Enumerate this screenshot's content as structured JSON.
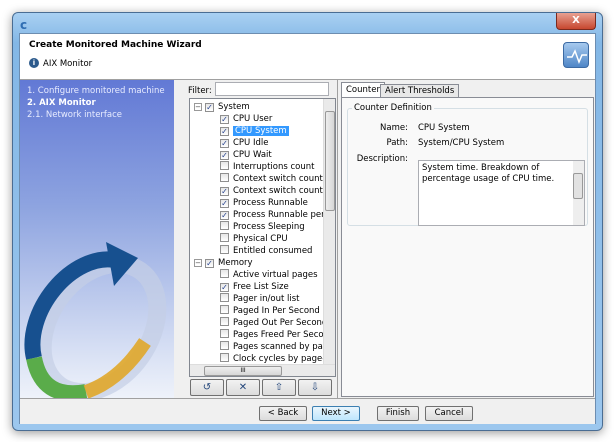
{
  "window": {
    "close_glyph": "X"
  },
  "header": {
    "title": "Create Monitored Machine Wizard",
    "subtitle": "AIX Monitor"
  },
  "steps": [
    {
      "label": "1. Configure monitored machine",
      "active": false
    },
    {
      "label": "2. AIX Monitor",
      "active": true
    },
    {
      "label": "2.1. Network interface",
      "active": false
    }
  ],
  "filter": {
    "label": "Filter:",
    "value": ""
  },
  "tree": [
    {
      "label": "System",
      "level": 0,
      "checked": true,
      "group": true
    },
    {
      "label": "CPU User",
      "level": 1,
      "checked": true
    },
    {
      "label": "CPU System",
      "level": 1,
      "checked": true,
      "selected": true
    },
    {
      "label": "CPU Idle",
      "level": 1,
      "checked": true
    },
    {
      "label": "CPU Wait",
      "level": 1,
      "checked": true
    },
    {
      "label": "Interruptions count",
      "level": 1,
      "checked": false
    },
    {
      "label": "Context switch count",
      "level": 1,
      "checked": false
    },
    {
      "label": "Context switch count per",
      "level": 1,
      "checked": true
    },
    {
      "label": "Process Runnable",
      "level": 1,
      "checked": true
    },
    {
      "label": "Process Runnable per CP",
      "level": 1,
      "checked": true
    },
    {
      "label": "Process Sleeping",
      "level": 1,
      "checked": false
    },
    {
      "label": "Physical CPU",
      "level": 1,
      "checked": false
    },
    {
      "label": "Entitled consumed",
      "level": 1,
      "checked": false
    },
    {
      "label": "Memory",
      "level": 0,
      "checked": true,
      "group": true
    },
    {
      "label": "Active virtual pages",
      "level": 1,
      "checked": false
    },
    {
      "label": "Free List Size",
      "level": 1,
      "checked": true
    },
    {
      "label": "Pager in/out list",
      "level": 1,
      "checked": false
    },
    {
      "label": "Paged In Per Second",
      "level": 1,
      "checked": false
    },
    {
      "label": "Paged Out Per Second",
      "level": 1,
      "checked": false
    },
    {
      "label": "Pages Freed Per Second",
      "level": 1,
      "checked": false
    },
    {
      "label": "Pages scanned by page-r",
      "level": 1,
      "checked": false
    },
    {
      "label": "Clock cycles by page-repl",
      "level": 1,
      "checked": false
    }
  ],
  "tree_buttons": [
    {
      "icon": "undo-icon",
      "glyph": "↺"
    },
    {
      "icon": "clear-icon",
      "glyph": "✕"
    },
    {
      "icon": "export-icon",
      "glyph": "⇧"
    },
    {
      "icon": "import-icon",
      "glyph": "⇩"
    }
  ],
  "tabs": [
    {
      "label": "Counter",
      "active": true
    },
    {
      "label": "Alert Thresholds",
      "active": false
    }
  ],
  "counter": {
    "group_title": "Counter Definition",
    "name_label": "Name:",
    "name": "CPU System",
    "path_label": "Path:",
    "path": "System/CPU System",
    "description_label": "Description:",
    "description": "System time. Breakdown of percentage usage of CPU time."
  },
  "footer": {
    "back": "< Back",
    "next": "Next >",
    "finish": "Finish",
    "cancel": "Cancel"
  }
}
